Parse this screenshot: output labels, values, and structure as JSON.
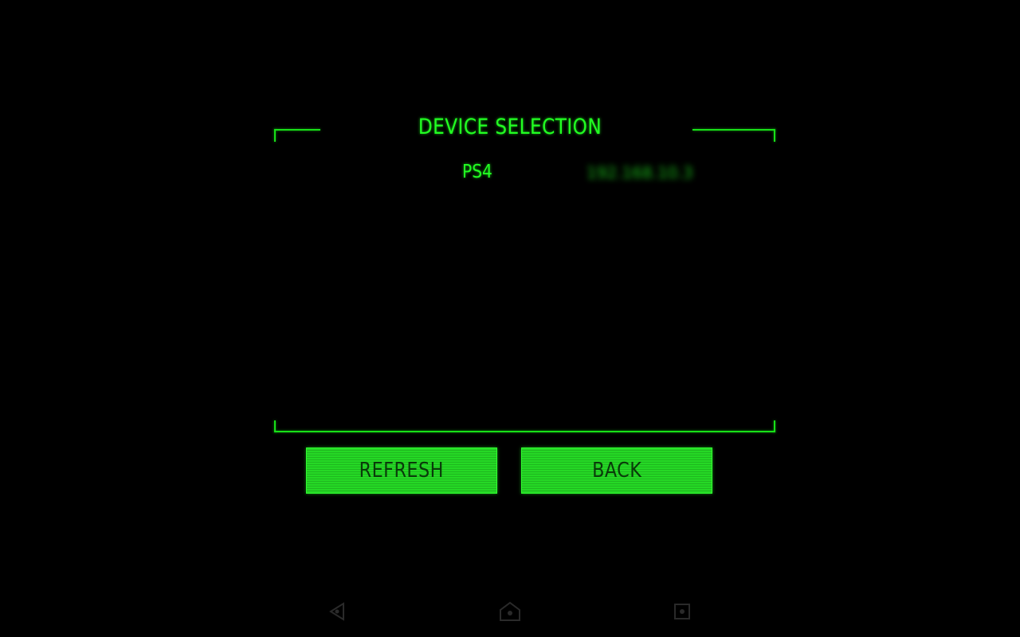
{
  "screen": {
    "title": "DEVICE SELECTION"
  },
  "devices": [
    {
      "name": "PS4",
      "address": "192.168.10.3"
    }
  ],
  "buttons": {
    "refresh_label": "REFRESH",
    "back_label": "BACK"
  },
  "colors": {
    "background": "#000000",
    "accent": "#22ff22",
    "button_fill": "#25d825",
    "button_text": "#0a3a0a"
  },
  "navbar": {
    "back_icon": "triangle-back-icon",
    "home_icon": "home-icon",
    "recent_icon": "square-recent-icon"
  }
}
